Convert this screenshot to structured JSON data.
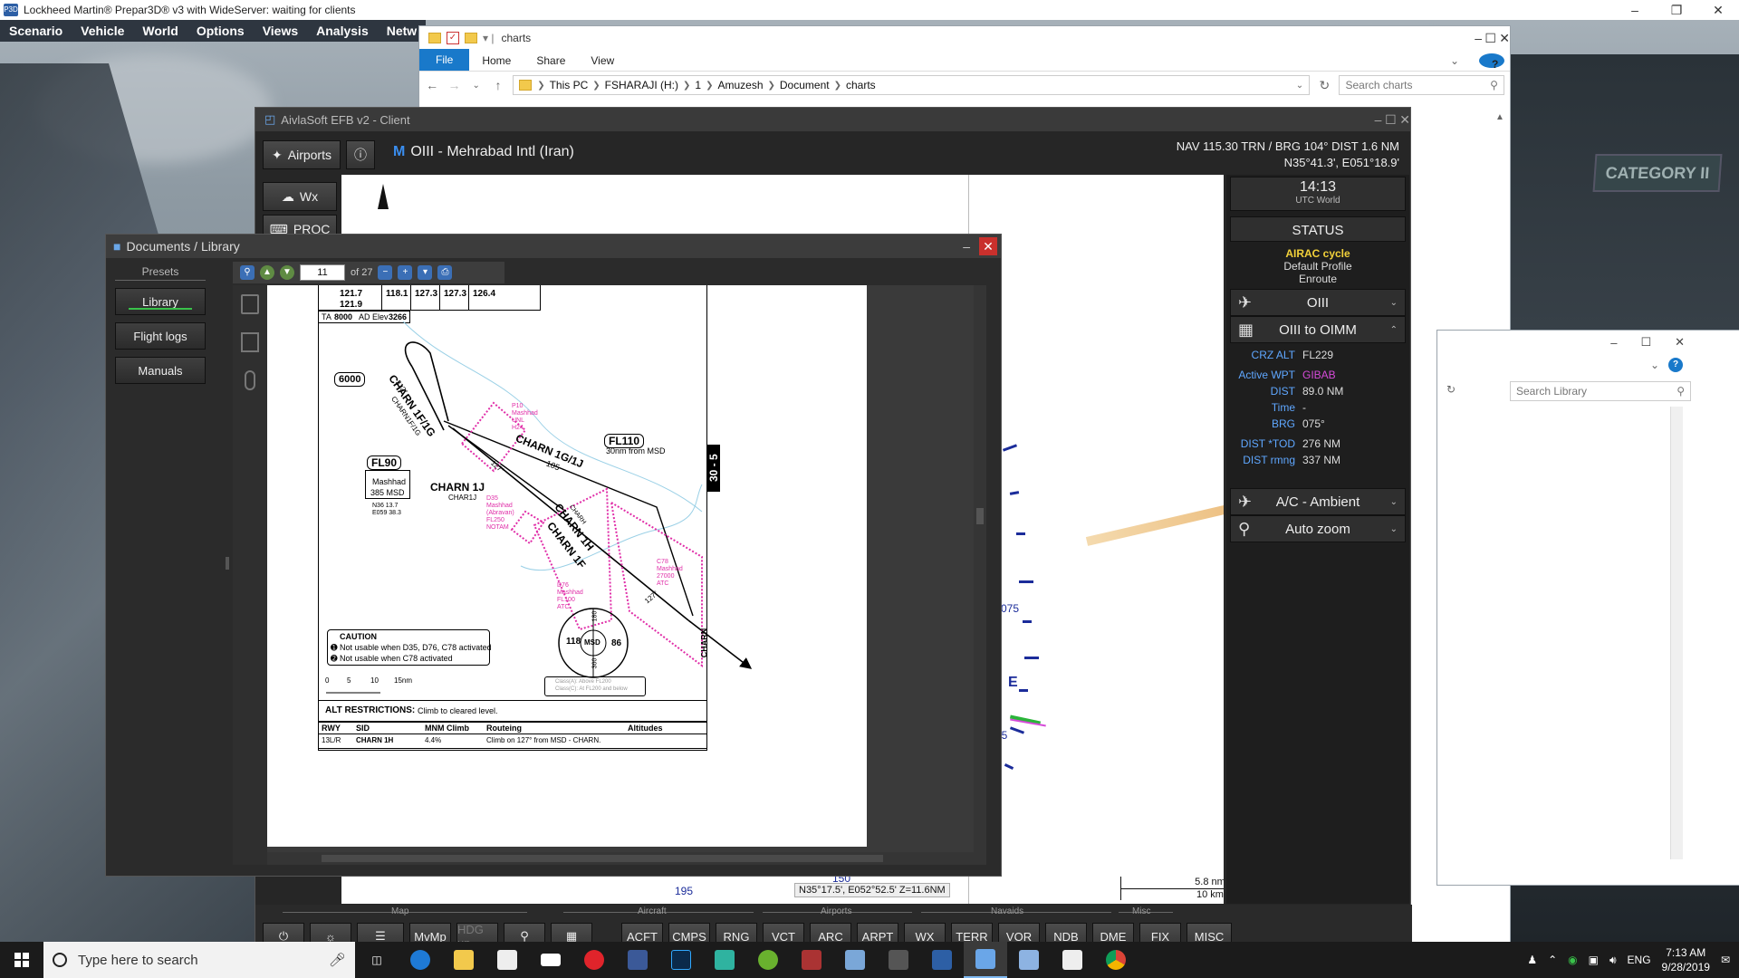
{
  "p3d": {
    "title": "Lockheed Martin® Prepar3D® v3 with WideServer: waiting for clients",
    "menu": [
      "Scenario",
      "Vehicle",
      "World",
      "Options",
      "Views",
      "Analysis",
      "Netw"
    ],
    "category_badge": "CATEGORY II"
  },
  "explorer": {
    "title": "charts",
    "tabs": [
      "File",
      "Home",
      "Share",
      "View"
    ],
    "breadcrumb": [
      "This PC",
      "FSHARAJI (H:)",
      "1",
      "Amuzesh",
      "Document",
      "charts"
    ],
    "search_placeholder": "Search charts",
    "help": "?"
  },
  "library_explorer": {
    "search_placeholder": "Search Library"
  },
  "efb": {
    "title": "AivlaSoft EFB v2 - Client",
    "airports_label": "Airports",
    "info_label": "ⓘ",
    "wx_label": "Wx",
    "proc_label": "PROC",
    "m_badge": "M",
    "airport_title": "OIII - Mehrabad Intl (Iran)",
    "nav_line1": "NAV 115.30 TRN / BRG 104°  DIST 1.6 NM",
    "nav_line2": "N35°41.3', E051°18.9'",
    "time": "14:13",
    "time_label": "UTC World",
    "status_label": "STATUS",
    "airac": "AIRAC cycle",
    "profile": "Default Profile",
    "phase": "Enroute",
    "airport_code": "OIII",
    "route": "OIII to OIMM",
    "route_info": [
      {
        "k": "CRZ ALT",
        "v": "FL229",
        "accent": ""
      },
      {
        "k": "Active WPT",
        "v": "GIBAB",
        "accent": "#d54bd8"
      },
      {
        "k": "DIST",
        "v": "89.0 NM",
        "accent": ""
      },
      {
        "k": "Time",
        "v": "-",
        "accent": ""
      },
      {
        "k": "BRG",
        "v": "075°",
        "accent": ""
      },
      {
        "k": "DIST *TOD",
        "v": "276 NM",
        "accent": ""
      },
      {
        "k": "DIST rmng",
        "v": "337 NM",
        "accent": ""
      }
    ],
    "ac_ambient": "A/C - Ambient",
    "auto_zoom": "Auto zoom",
    "map": {
      "compass_labels": [
        "075",
        "E",
        "195",
        "150",
        "05"
      ],
      "coords": "N35°17.5', E052°52.5' Z=11.6NM",
      "scale_top": "5.8 nm",
      "scale_bottom": "10 km"
    },
    "bottom_groups": [
      "Map",
      "Aircraft",
      "Airports",
      "Navaids",
      "Misc"
    ],
    "bottom_buttons": [
      "MvMp",
      "HDG up",
      "ACFT",
      "CMPS",
      "RNG",
      "VCT",
      "ARC",
      "ARPT",
      "WX",
      "TERR",
      "VOR",
      "NDB",
      "DME",
      "FIX",
      "MISC"
    ]
  },
  "doclib": {
    "title": "Documents / Library",
    "presets_label": "Presets",
    "presets": [
      "Library",
      "Flight logs",
      "Manuals"
    ],
    "page": "11",
    "page_of": "of 27"
  },
  "chart": {
    "freqs_top": [
      "121.7",
      "121.9",
      "118.1",
      "127.3",
      "127.3",
      "126.4"
    ],
    "ta": "TA",
    "ta_val": "8000",
    "ad_elev": "AD Elev",
    "ad_elev_val": "3266",
    "alt_6000": "6000",
    "fl90": "FL90",
    "mashhad": "Mashhad",
    "msd_385": "385 MSD",
    "msd_coords1": "N36 13.7",
    "msd_coords2": "E059 38.3",
    "charn_1f1g": "CHARN 1F/1G",
    "charn_1f1g_small": "CHARN1F/1G",
    "hdg_312": "312°",
    "charn_1g1j": "CHARN 1G/1J",
    "n105": "105",
    "fl110": "FL110",
    "nm30": "30nm from MSD",
    "charn_1j": "CHARN 1J",
    "charn_1j_small": "CHAR1J",
    "hdg_127a": "127°",
    "p10": [
      "P10",
      "Mashhad",
      "UNL",
      "H24"
    ],
    "d35": [
      "D35",
      "Mashhad",
      "(Abravan)",
      "FL250",
      "NOTAM"
    ],
    "charn_1h": "CHARN 1H",
    "charn_1f": "CHARN 1F",
    "charn_1h_small": "CHARH",
    "d76": [
      "D76",
      "Mashhad",
      "FL100",
      "ATC"
    ],
    "c78": [
      "C78",
      "Mashhad",
      "27000",
      "ATC"
    ],
    "hdg_127b": "127°",
    "charn_fix": "CHARN",
    "side_tab": "30 - 5",
    "msd_circle": "MSD",
    "msd_118": "118",
    "msd_86": "86",
    "msd_180": "180",
    "msd_360": "360",
    "caution_title": "CAUTION",
    "caution_1": "Not usable when D35, D76, C78 activated",
    "caution_2": "Not usable when C78 activated",
    "scale": [
      "0",
      "5",
      "10",
      "15nm"
    ],
    "class_note": [
      "Class(A): Above FL200",
      "Class(C): At FL200 and below"
    ],
    "alt_restr_label": "ALT RESTRICTIONS:",
    "alt_restr_val": "Climb to cleared level.",
    "table_headers": [
      "RWY",
      "SID",
      "MNM Climb",
      "Routeing",
      "Altitudes"
    ],
    "table_row": [
      "13L/R",
      "CHARN 1H",
      "4.4%",
      "Climb on 127° from MSD - CHARN.",
      ""
    ]
  },
  "taskbar": {
    "search_placeholder": "Type here to search",
    "lang": "ENG",
    "time": "7:13 AM",
    "date": "9/28/2019"
  }
}
